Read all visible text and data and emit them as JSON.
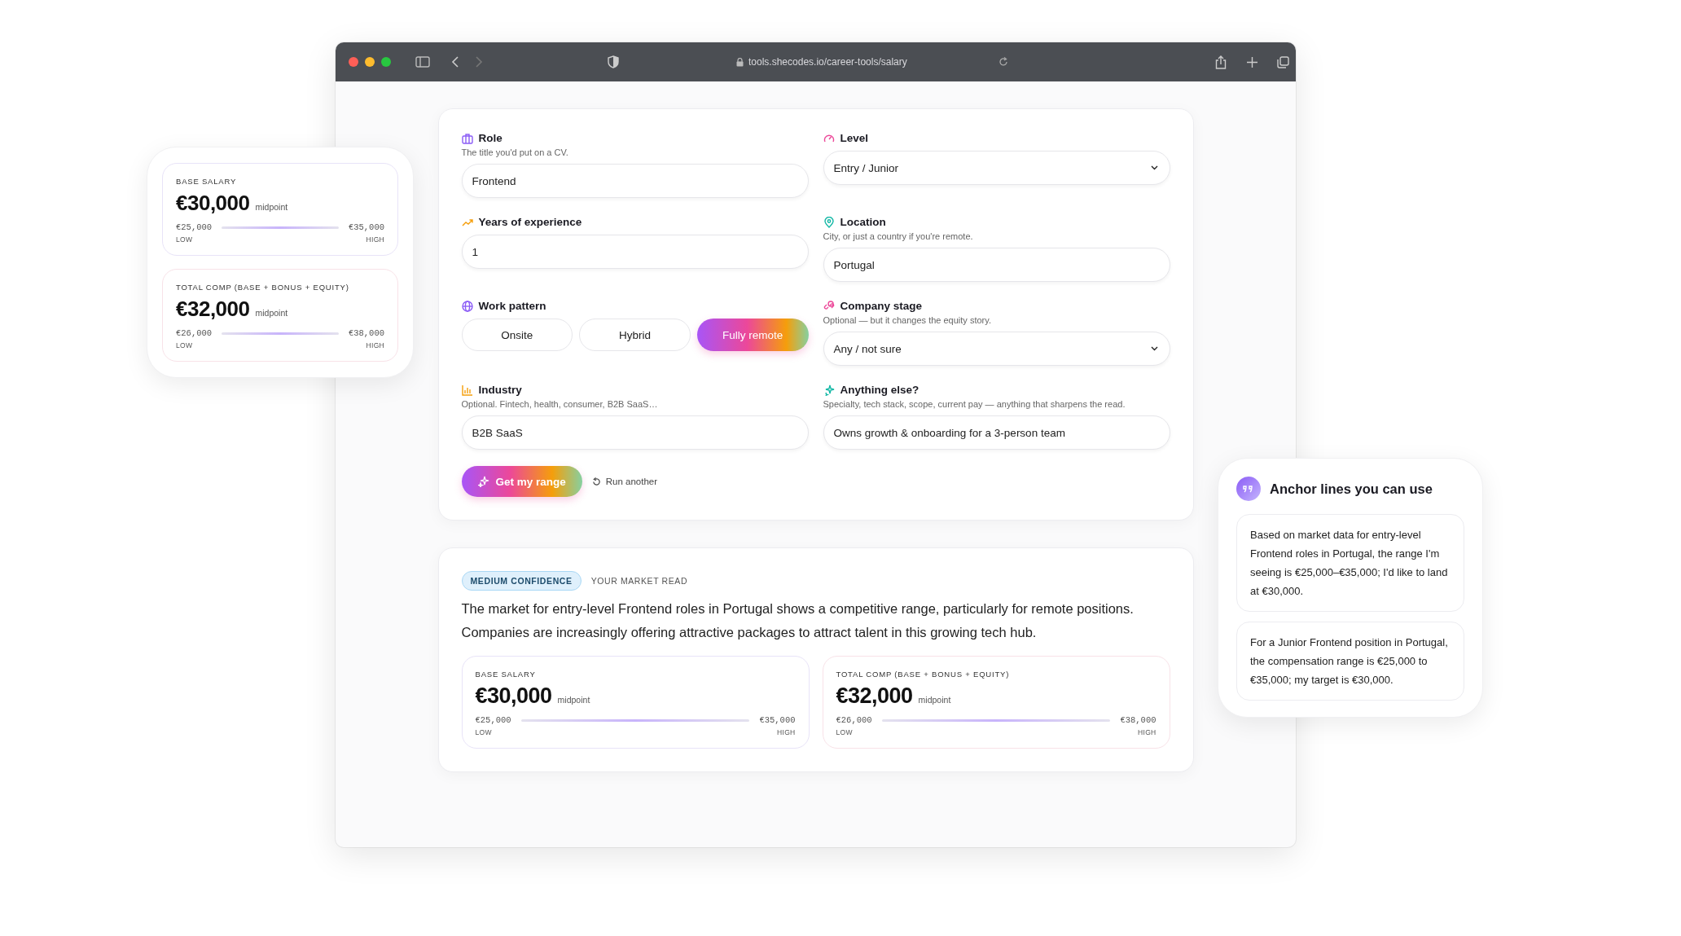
{
  "browser": {
    "url": "tools.shecodes.io/career-tools/salary"
  },
  "form": {
    "fields": [
      {
        "kind": "text",
        "label": "Role",
        "hint": "The title you'd put on a CV.",
        "value": "Frontend"
      },
      {
        "kind": "select",
        "label": "Level",
        "value": "Entry / Junior"
      },
      {
        "kind": "text",
        "label": "Years of experience",
        "value": "1"
      },
      {
        "kind": "text",
        "label": "Location",
        "hint": "City, or just a country if you're remote.",
        "value": "Portugal"
      },
      {
        "kind": "choice",
        "label": "Work pattern",
        "options": [
          {
            "label": "Onsite",
            "selected": false
          },
          {
            "label": "Hybrid",
            "selected": false
          },
          {
            "label": "Fully remote",
            "selected": true
          }
        ]
      },
      {
        "kind": "select",
        "label": "Company stage",
        "hint": "Optional — but it changes the equity story.",
        "value": "Any / not sure"
      },
      {
        "kind": "text",
        "label": "Industry",
        "hint": "Optional. Fintech, health, consumer, B2B SaaS…",
        "value": "B2B SaaS"
      },
      {
        "kind": "text",
        "label": "Anything else?",
        "hint": "Specialty, tech stack, scope, current pay — anything that sharpens the read.",
        "value": "Owns growth & onboarding for a 3-person team"
      }
    ],
    "actions": {
      "submit": "Get my range",
      "reset": "Run another"
    }
  },
  "results": {
    "confidence": "MEDIUM CONFIDENCE",
    "heading": "YOUR MARKET READ",
    "summary": "The market for entry-level Frontend roles in Portugal shows a competitive range, particularly for remote positions. Companies are increasingly offering attractive packages to attract talent in this growing tech hub.",
    "ranges": [
      {
        "label": "BASE SALARY",
        "amount": "€30,000",
        "note": "midpoint",
        "low": "€25,000",
        "high": "€35,000",
        "low_label": "LOW",
        "high_label": "HIGH",
        "color": "#e8e3f8"
      },
      {
        "label": "TOTAL COMP (BASE + BONUS + EQUITY)",
        "amount": "€32,000",
        "note": "midpoint",
        "low": "€26,000",
        "high": "€38,000",
        "low_label": "LOW",
        "high_label": "HIGH",
        "color": "#f8e2e8"
      }
    ]
  },
  "summary_card": {
    "ranges": [
      {
        "label": "BASE SALARY",
        "amount": "€30,000",
        "note": "midpoint",
        "low": "€25,000",
        "high": "€35,000",
        "low_label": "LOW",
        "high_label": "HIGH",
        "color": "#e8e3f8"
      },
      {
        "label": "TOTAL COMP (BASE + BONUS + EQUITY)",
        "amount": "€32,000",
        "note": "midpoint",
        "low": "€26,000",
        "high": "€38,000",
        "low_label": "LOW",
        "high_label": "HIGH",
        "color": "#f8e2e8"
      }
    ]
  },
  "anchor_card": {
    "title": "Anchor lines you can use",
    "lines": [
      "Based on market data for entry-level Frontend roles in Portugal, the range I'm seeing is €25,000–€35,000; I'd like to land at €30,000.",
      "For a Junior Frontend position in Portugal, the compensation range is €25,000 to €35,000; my target is €30,000."
    ]
  }
}
